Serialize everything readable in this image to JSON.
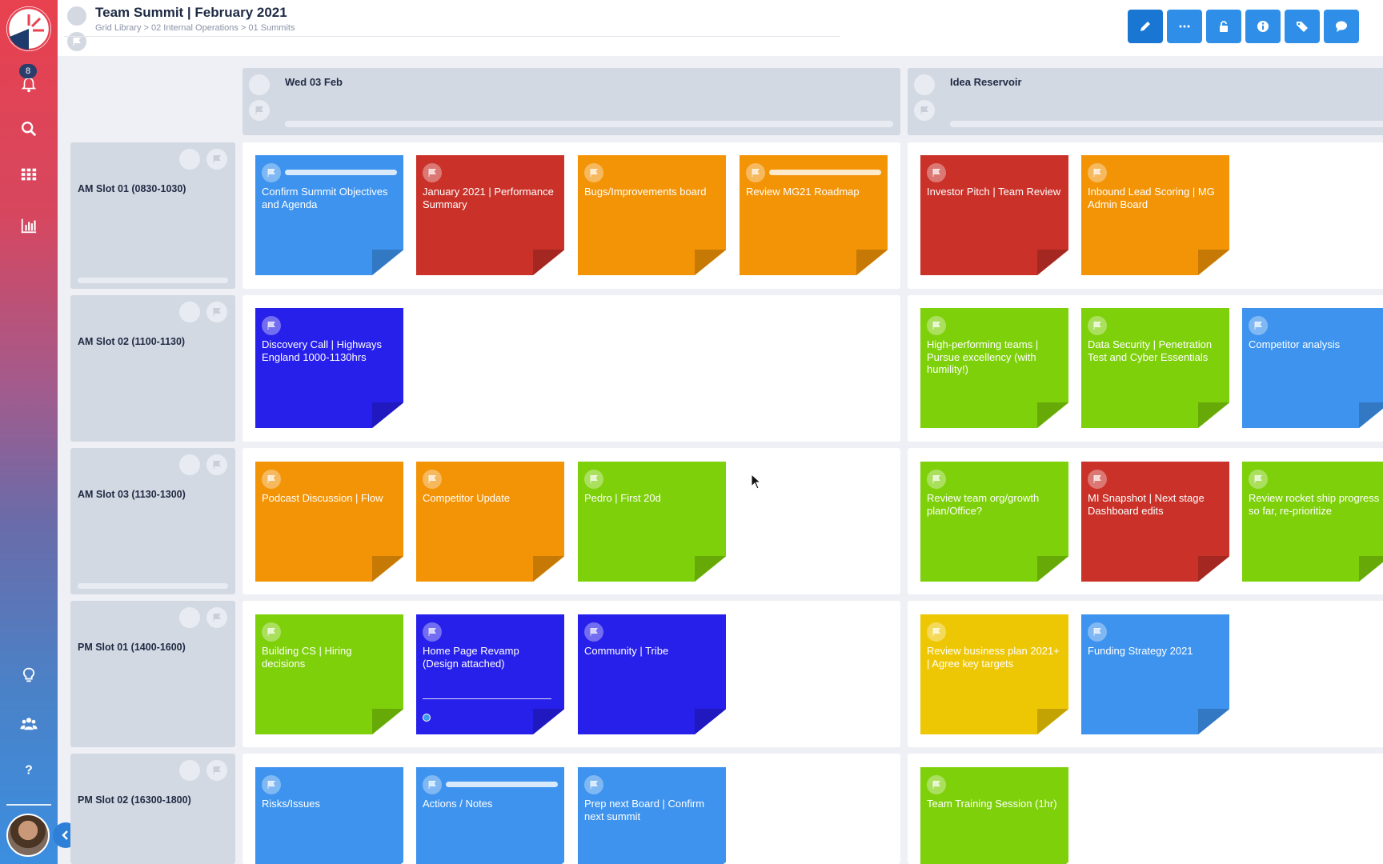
{
  "sidebar": {
    "notifications_count": "8",
    "icons": [
      "bell-icon",
      "search-icon",
      "grid-icon",
      "chart-icon",
      "lightbulb-icon",
      "team-icon",
      "help-icon"
    ]
  },
  "header": {
    "title": "Team Summit | February 2021",
    "breadcrumb": "Grid Library > 02 Internal Operations > 01 Summits",
    "toolbar": [
      "edit-icon",
      "more-icon",
      "lock-icon",
      "info-icon",
      "tags-icon",
      "comment-icon"
    ]
  },
  "columns": [
    {
      "title": "Wed 03 Feb"
    },
    {
      "title": "Idea Reservoir"
    }
  ],
  "rows": [
    {
      "title": "AM Slot 01 (0830-1030)"
    },
    {
      "title": "AM Slot 02 (1100-1130)"
    },
    {
      "title": "AM Slot 03 (1130-1300)"
    },
    {
      "title": "PM Slot 01 (1400-1600)"
    },
    {
      "title": "PM Slot 02 (16300-1800)"
    }
  ],
  "cards": {
    "r0c0": [
      "Confirm Summit Objectives and Agenda",
      "January 2021 | Performance Summary",
      "Bugs/Improvements board",
      "Review MG21 Roadmap"
    ],
    "r0c1": [
      "Investor Pitch | Team Review",
      "Inbound Lead Scoring | MG Admin Board"
    ],
    "r1c0": [
      "Discovery Call | Highways England 1000-1130hrs"
    ],
    "r1c1": [
      "High-performing teams | Pursue excellency (with humility!)",
      "Data Security | Penetration Test and Cyber Essentials",
      "Competitor analysis"
    ],
    "r2c0": [
      "Podcast Discussion | Flow",
      "Competitor Update",
      "Pedro | First 20d"
    ],
    "r2c1": [
      "Review team org/growth plan/Office?",
      "MI Snapshot | Next stage Dashboard edits",
      "Review rocket ship progress so far, re-prioritize"
    ],
    "r3c0": [
      "Building CS | Hiring decisions",
      "Home Page Revamp (Design attached)",
      "Community | Tribe"
    ],
    "r3c1": [
      "Review business plan 2021+ | Agree key targets",
      "Funding Strategy 2021"
    ],
    "r4c0": [
      "Risks/Issues",
      "Actions / Notes",
      "Prep next Board | Confirm next summit"
    ],
    "r4c1": [
      "Team Training Session (1hr)"
    ]
  },
  "card_colors": {
    "blue": "#3d93ee",
    "red": "#c93129",
    "orange": "#f39407",
    "indigo": "#271fea",
    "green": "#7ed00a",
    "yellow": "#eec704"
  }
}
